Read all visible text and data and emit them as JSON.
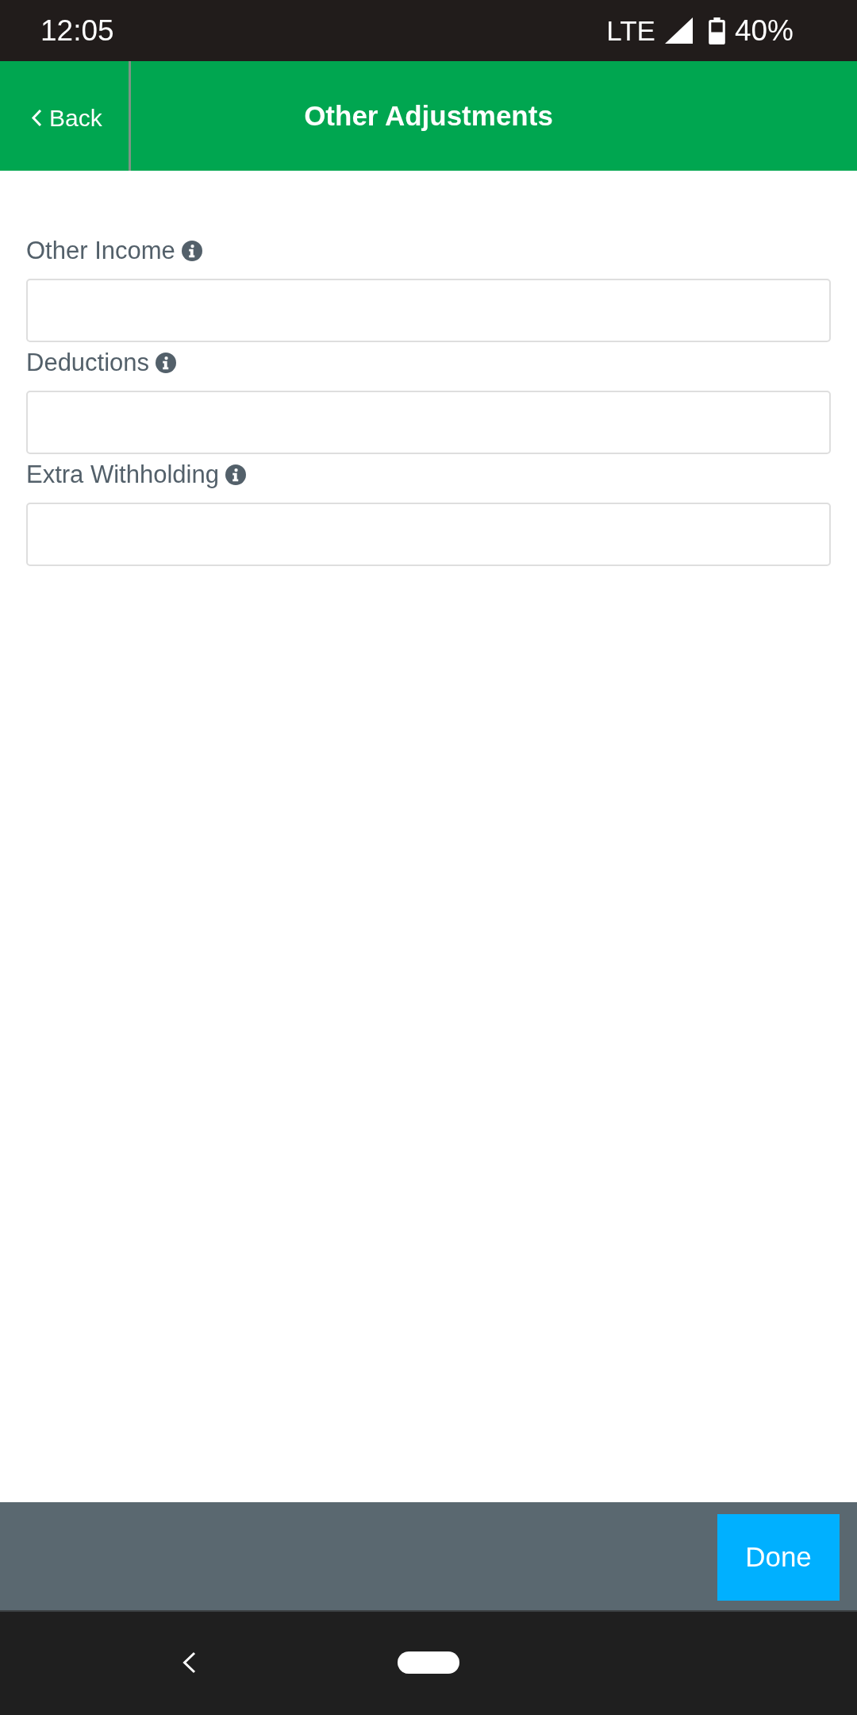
{
  "status_bar": {
    "time": "12:05",
    "network": "LTE",
    "battery": "40%"
  },
  "header": {
    "back": "Back",
    "title": "Other Adjustments"
  },
  "fields": [
    {
      "label": "Other Income"
    },
    {
      "label": "Deductions"
    },
    {
      "label": "Extra Withholding"
    }
  ],
  "footer": {
    "button": "Done"
  }
}
